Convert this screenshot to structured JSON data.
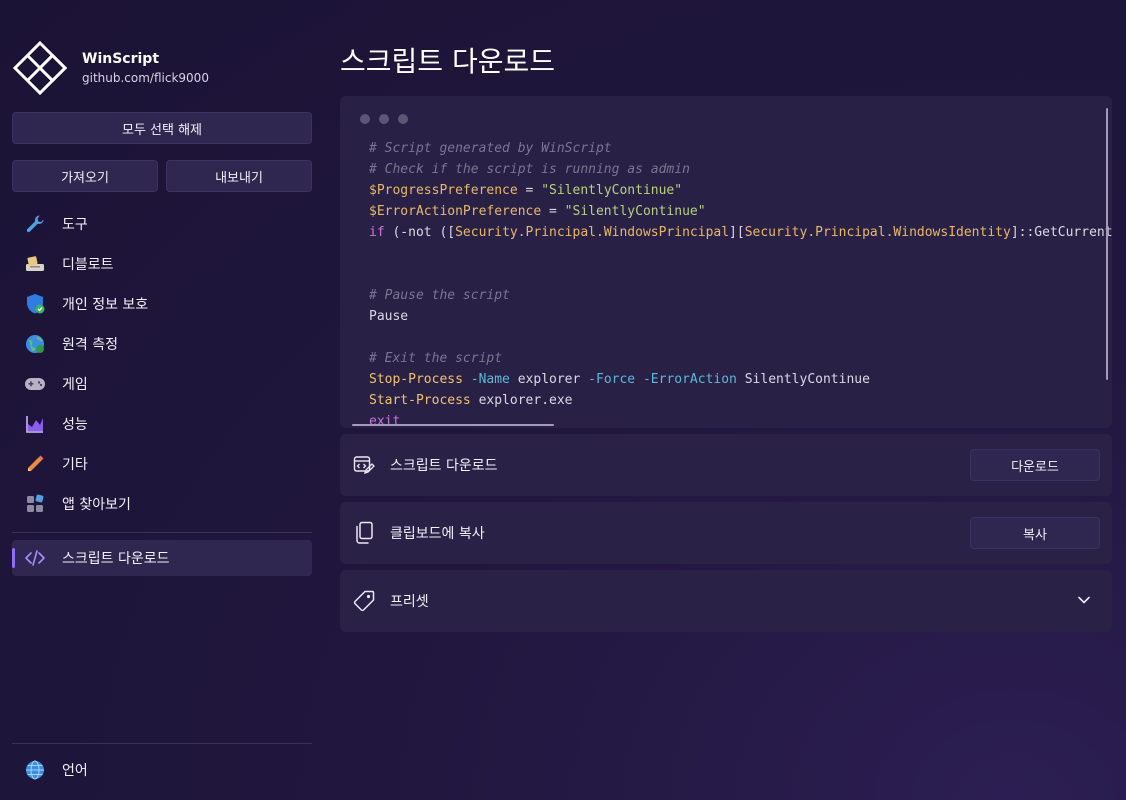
{
  "app": {
    "name": "WinScript",
    "url": "github.com/flick9000"
  },
  "sidebar": {
    "clear_all_label": "모두 선택 해제",
    "import_label": "가져오기",
    "export_label": "내보내기",
    "items": [
      {
        "label": "도구",
        "icon": "wrench-icon"
      },
      {
        "label": "디블로트",
        "icon": "debloat-icon"
      },
      {
        "label": "개인 정보 보호",
        "icon": "shield-icon"
      },
      {
        "label": "원격 측정",
        "icon": "globe-icon"
      },
      {
        "label": "게임",
        "icon": "gamepad-icon"
      },
      {
        "label": "성능",
        "icon": "chart-icon"
      },
      {
        "label": "기타",
        "icon": "pencil-icon"
      },
      {
        "label": "앱 찾아보기",
        "icon": "apps-icon"
      }
    ],
    "active_item": {
      "label": "스크립트 다운로드",
      "icon": "code-icon"
    },
    "language_item": {
      "label": "언어",
      "icon": "globe-icon"
    }
  },
  "main": {
    "title": "스크립트 다운로드",
    "code_lines": [
      "# Script generated by WinScript",
      "# Check if the script is running as admin",
      "$ProgressPreference = \"SilentlyContinue\"",
      "$ErrorActionPreference = \"SilentlyContinue\"",
      "if (-not ([Security.Principal.WindowsPrincipal][Security.Principal.WindowsIdentity]::GetCurrent()",
      "",
      "",
      "# Pause the script",
      "Pause",
      "",
      "# Exit the script",
      "Stop-Process -Name explorer -Force -ErrorAction SilentlyContinue",
      "Start-Process explorer.exe",
      "exit"
    ],
    "download_row": {
      "label": "스크립트 다운로드",
      "button": "다운로드",
      "icon": "code-file-icon"
    },
    "copy_row": {
      "label": "클립보드에 복사",
      "button": "복사",
      "icon": "copy-icon"
    },
    "preset_row": {
      "label": "프리셋",
      "icon": "tag-icon"
    }
  },
  "colors": {
    "accent": "#8f6bff",
    "background": "#1b1335",
    "card": "#292046"
  }
}
